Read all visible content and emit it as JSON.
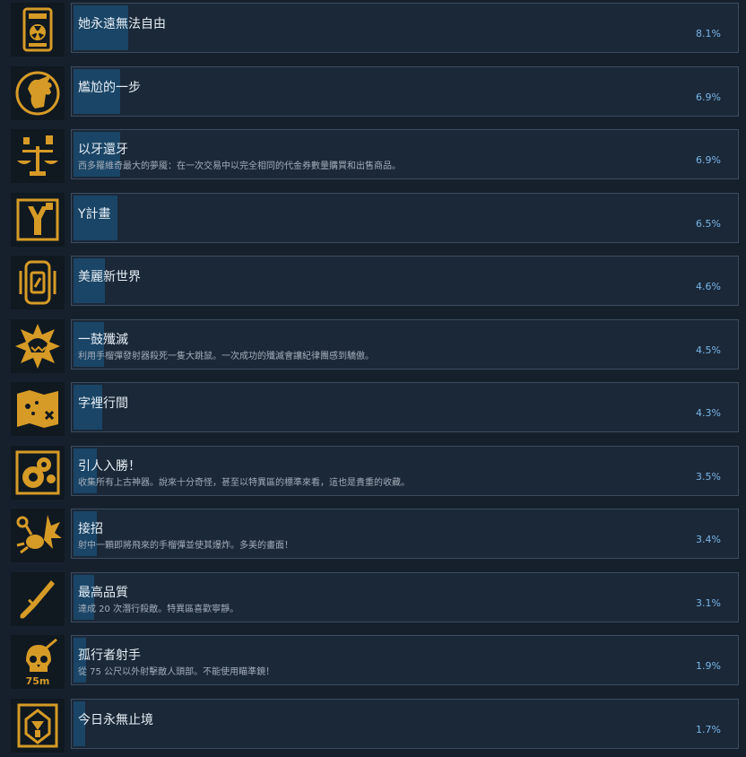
{
  "colors": {
    "background": "#16202d",
    "panel": "#1b2838",
    "progress_fill": "#1a4566",
    "icon_gold": "#d69b26",
    "percent_text": "#79b6e8"
  },
  "achievements": [
    {
      "icon": "hazard-badge-icon",
      "title": "她永遠無法自由",
      "desc": "",
      "percent": "8.1%",
      "fraction": 0.081
    },
    {
      "icon": "hand-on-face-icon",
      "title": "尷尬的一步",
      "desc": "",
      "percent": "6.9%",
      "fraction": 0.069
    },
    {
      "icon": "scales-icon",
      "title": "以牙還牙",
      "desc": "西多羅維奇最大的夢魇：在一次交易中以完全相同的代金券數量購買和出售商品。",
      "percent": "6.9%",
      "fraction": 0.069
    },
    {
      "icon": "y-emblem-icon",
      "title": "Y計畫",
      "desc": "",
      "percent": "6.5%",
      "fraction": 0.065
    },
    {
      "icon": "canister-icon",
      "title": "美麗新世界",
      "desc": "",
      "percent": "4.6%",
      "fraction": 0.046
    },
    {
      "icon": "mutant-explosion-icon",
      "title": "一鼓殲滅",
      "desc": "利用手榴彈發射器殺死一隻大跳鼠。一次成功的殲滅會讓紀律團感到驕傲。",
      "percent": "4.5%",
      "fraction": 0.045
    },
    {
      "icon": "map-icon",
      "title": "字裡行間",
      "desc": "",
      "percent": "4.3%",
      "fraction": 0.043
    },
    {
      "icon": "artifacts-icon",
      "title": "引人入勝！",
      "desc": "收集所有上古神器。說來十分奇怪，甚至以特異區的標準來看，這也是貴重的收藏。",
      "percent": "3.5%",
      "fraction": 0.035
    },
    {
      "icon": "grenade-burst-icon",
      "title": "接招",
      "desc": "射中一顆即將飛來的手榴彈並使其爆炸。多美的畫面！",
      "percent": "3.4%",
      "fraction": 0.034
    },
    {
      "icon": "knife-icon",
      "title": "最高品質",
      "desc": "達成 20 次潛行殺敵。特異區喜歡寧靜。",
      "percent": "3.1%",
      "fraction": 0.031
    },
    {
      "icon": "skull-75m-icon",
      "title": "孤行者射手",
      "desc": "從 75 公尺以外射擊敵人頭部。不能使用瞄準鏡！",
      "percent": "1.9%",
      "fraction": 0.019,
      "icon_text": "75m"
    },
    {
      "icon": "eternal-emblem-icon",
      "title": "今日永無止境",
      "desc": "",
      "percent": "1.7%",
      "fraction": 0.017
    }
  ]
}
